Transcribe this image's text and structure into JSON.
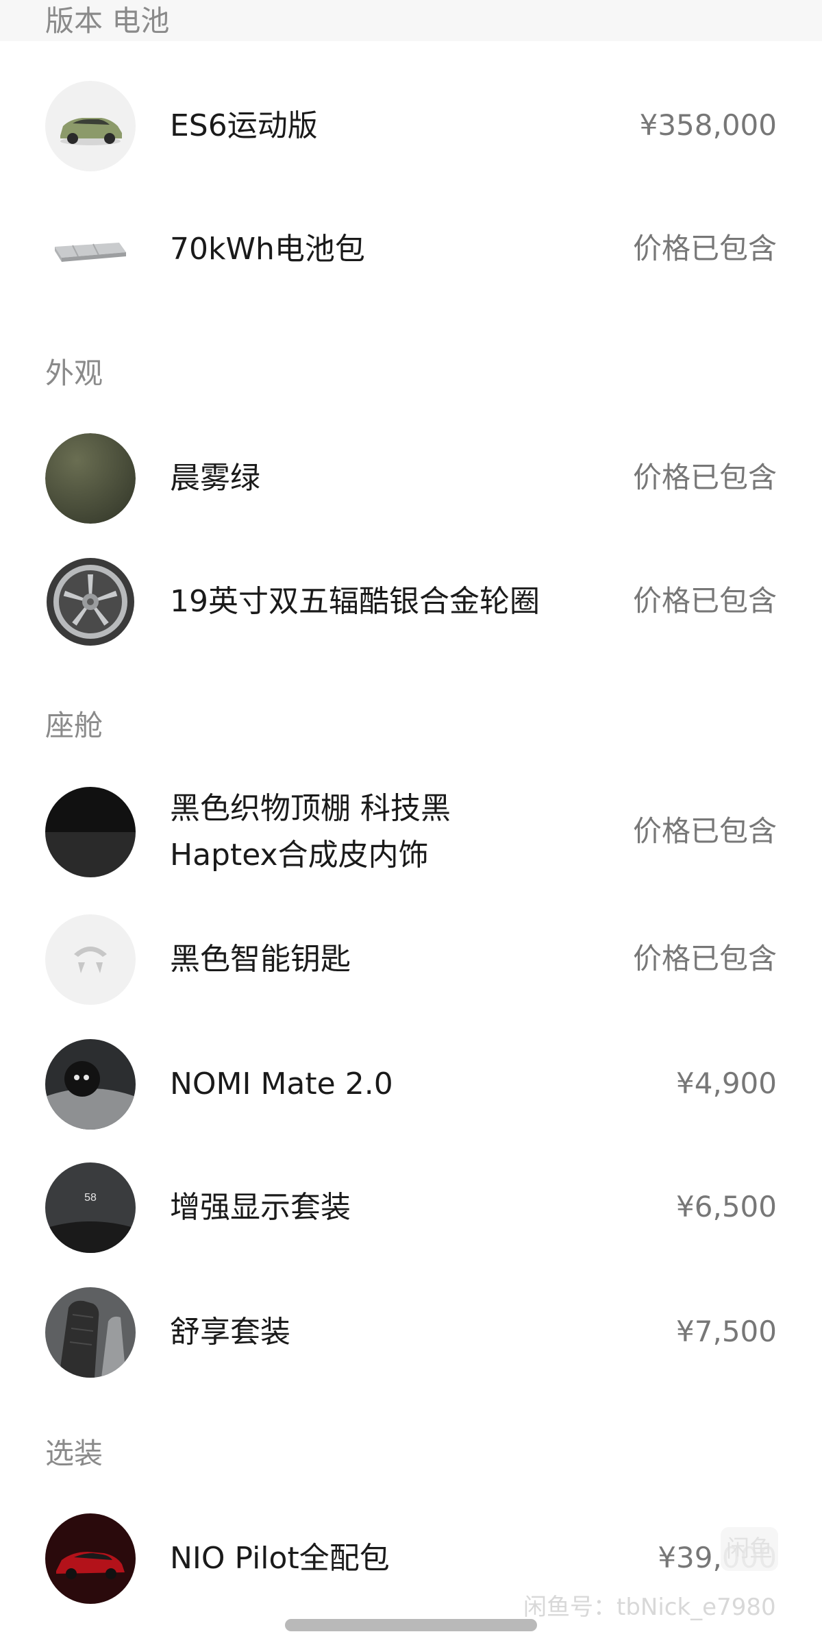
{
  "sections": {
    "version_battery": "版本 电池",
    "exterior": "外观",
    "cabin": "座舱",
    "optional": "选装"
  },
  "items": {
    "model": {
      "name": "ES6运动版",
      "price": "¥358,000",
      "icon": "car-image"
    },
    "battery": {
      "name": "70kWh电池包",
      "price": "价格已包含",
      "icon": "battery-pack-image"
    },
    "paint": {
      "name": "晨雾绿",
      "price": "价格已包含",
      "icon": "paint-swatch",
      "color": "#4c5038"
    },
    "wheels": {
      "name": "19英寸双五辐酷银合金轮圈",
      "price": "价格已包含",
      "icon": "wheel-image"
    },
    "interior": {
      "name_line1": "黑色织物顶棚 科技黑",
      "name_line2": "Haptex合成皮内饰",
      "price": "价格已包含",
      "icon": "interior-swatch"
    },
    "key": {
      "name": "黑色智能钥匙",
      "price": "价格已包含",
      "icon": "nio-logo"
    },
    "nomi": {
      "name": "NOMI Mate 2.0",
      "price": "¥4,900",
      "icon": "nomi-robot-image"
    },
    "display": {
      "name": "增强显示套装",
      "price": "¥6,500",
      "icon": "hud-display-image",
      "hud_value": "58"
    },
    "comfort": {
      "name": "舒享套装",
      "price": "¥7,500",
      "icon": "seat-image"
    },
    "pilot": {
      "name": "NIO Pilot全配包",
      "price": "¥39,000",
      "icon": "red-car-image"
    }
  },
  "watermark": {
    "text": "闲鱼号：tbNick_e7980",
    "logo": "闲鱼"
  }
}
